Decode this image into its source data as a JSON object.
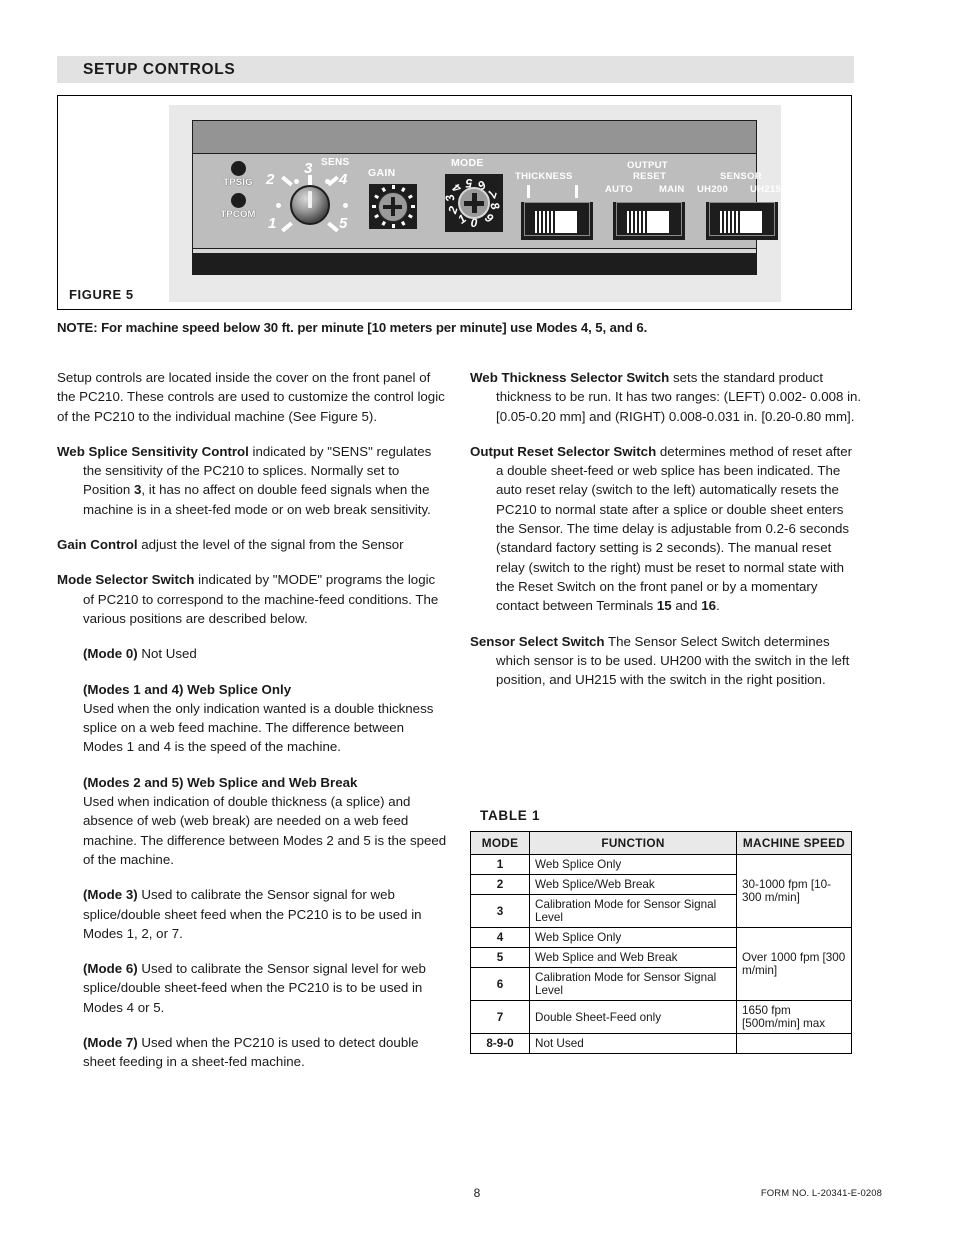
{
  "section": {
    "title": "SETUP CONTROLS"
  },
  "figure": {
    "caption": "FIGURE  5",
    "panel": {
      "test_points": [
        {
          "label": "TPSIG"
        },
        {
          "label": "TPCOM"
        }
      ],
      "sens": {
        "caption": "SENS",
        "positions": [
          "1",
          "2",
          "3",
          "4",
          "5"
        ]
      },
      "gain": {
        "caption": "GAIN"
      },
      "mode": {
        "caption": "MODE",
        "digits": [
          "0",
          "1",
          "2",
          "3",
          "4",
          "5",
          "6",
          "7",
          "8",
          "9"
        ]
      },
      "switches": [
        {
          "caption_lines": [
            "THICKNESS"
          ],
          "left_label": "",
          "right_label": ""
        },
        {
          "caption_lines": [
            "OUTPUT",
            "RESET"
          ],
          "left_label": "AUTO",
          "right_label": "MAIN"
        },
        {
          "caption_lines": [
            "SENSOR"
          ],
          "left_label": "UH200",
          "right_label": "UH215"
        }
      ]
    }
  },
  "note": "NOTE: For machine speed below 30 ft. per minute [10 meters per minute] use Modes 4, 5, and 6.",
  "left_column": {
    "intro": "Setup controls are located inside the cover on the front panel of the PC210. These controls are used to customize the control logic of the PC210 to the individual machine (See Figure 5).",
    "web_splice_sensitivity": {
      "term": "Web Splice Sensitivity Control",
      "text_before_position": " indicated by \"SENS\" regulates the sensitivity of the PC210 to splices. Normally set to Position ",
      "position": "3",
      "text_after_position": ", it has no affect on double feed signals when the machine is in a sheet-fed mode or on web break sensitivity."
    },
    "gain_control": {
      "term": "Gain Control",
      "text": " adjust the level of the signal from the Sensor"
    },
    "mode_selector": {
      "term": "Mode Selector Switch",
      "text": " indicated by \"MODE\" programs the logic of PC210 to correspond to the machine-feed conditions.  The various positions are described below."
    },
    "modes": [
      {
        "heading": "(Mode 0)",
        "heading_rest": " Not Used",
        "body": ""
      },
      {
        "heading": "(Modes 1 and 4) Web Splice Only",
        "heading_rest": "",
        "body": "Used when the only indication wanted is a double thickness splice on a web feed machine.  The difference between Modes 1 and 4 is the speed of the machine."
      },
      {
        "heading": "(Modes 2 and 5) Web Splice and Web Break",
        "heading_rest": "",
        "body": "Used when indication of double thickness (a splice) and absence of web (web break) are needed on a web feed machine.  The difference between Modes 2 and 5 is the speed of the machine."
      },
      {
        "heading": "(Mode 3)",
        "heading_rest": " Used to calibrate the Sensor signal for web splice/double sheet feed when the PC210 is to be used in Modes 1, 2, or 7.",
        "body": ""
      },
      {
        "heading": "(Mode 6)",
        "heading_rest": " Used to calibrate the Sensor signal level for web splice/double sheet-feed when the PC210 is to be used in Modes 4 or 5.",
        "body": ""
      },
      {
        "heading": "(Mode 7)",
        "heading_rest": " Used when the PC210 is used to detect double sheet feeding in a sheet-fed machine.",
        "body": ""
      }
    ]
  },
  "right_column": {
    "web_thickness": {
      "term": "Web Thickness Selector Switch",
      "text": " sets the standard product thickness to be run.  It has two ranges: (LEFT) 0.002- 0.008 in. [0.05-0.20 mm] and (RIGHT) 0.008-0.031 in. [0.20-0.80 mm]."
    },
    "output_reset": {
      "term": "Output Reset Selector Switch",
      "text_1": "  determines method of reset after a double sheet-feed or web splice has been indicated.  The auto reset relay (switch to the left) automatically resets the PC210 to normal state after a splice or double sheet enters the Sensor. The time delay is adjustable from 0.2-6 seconds (standard factory setting is 2 seconds). The manual reset relay (switch to the right) must be reset to normal state with the Reset Switch on the front panel or by a momentary contact between Terminals ",
      "terminal_1": "15",
      "text_2": " and ",
      "terminal_2": "16",
      "text_3": "."
    },
    "sensor_select": {
      "term": "Sensor Select Switch",
      "text": "  The Sensor Select Switch determines which sensor is to be used.  UH200 with the switch in the left position, and UH215 with the switch in the right position."
    }
  },
  "table": {
    "caption": "TABLE  1",
    "headers": [
      "MODE",
      "FUNCTION",
      "MACHINE SPEED"
    ],
    "rows": [
      {
        "mode": "1",
        "function": "Web Splice Only"
      },
      {
        "mode": "2",
        "function": "Web Splice/Web Break"
      },
      {
        "mode": "3",
        "function": "Calibration Mode for Sensor Signal Level"
      },
      {
        "mode": "4",
        "function": "Web Splice Only"
      },
      {
        "mode": "5",
        "function": "Web Splice and Web Break"
      },
      {
        "mode": "6",
        "function": "Calibration Mode for Sensor Signal Level"
      },
      {
        "mode": "7",
        "function": "Double Sheet-Feed only"
      },
      {
        "mode": "8-9-0",
        "function": "Not Used"
      }
    ],
    "speeds": {
      "group_1": "30-1000 fpm [10-300 m/min]",
      "group_2": "Over 1000 fpm [300 m/min]",
      "row_7": "1650 fpm [500m/min] max",
      "row_8": ""
    }
  },
  "footer": {
    "page_number": "8",
    "form_number": "FORM NO. L-20341-E-0208"
  }
}
